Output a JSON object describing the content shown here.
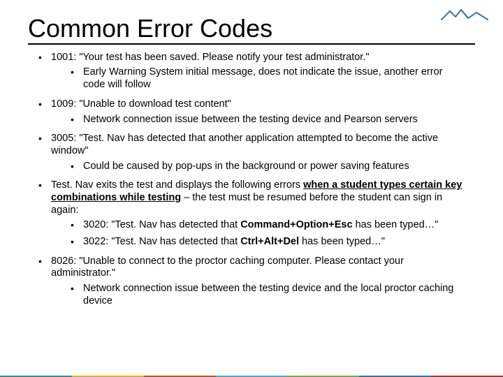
{
  "title": "Common Error Codes",
  "logo": {
    "name": "mountain-logo",
    "color": "#3f7aa6"
  },
  "bullets": [
    {
      "text": "1001: \"Your test has been saved. Please notify your test administrator.\"",
      "sub": [
        {
          "text": "Early Warning System initial message, does not indicate the issue, another error code will follow"
        }
      ]
    },
    {
      "text": "1009: \"Unable to download test content\"",
      "sub": [
        {
          "text": "Network connection issue between the testing device and Pearson servers"
        }
      ]
    },
    {
      "text": "3005: \"Test. Nav has detected that another application attempted to become the active window\"",
      "sub": [
        {
          "text": "Could be caused by pop-ups in the background or power saving features"
        }
      ]
    },
    {
      "pre": "Test. Nav exits the test and displays the following errors ",
      "bold_u": "when a student types certain key combinations while testing",
      "post": " – the test must be resumed before the student can sign in again:",
      "sub": [
        {
          "pre": "3020: \"Test. Nav has detected that ",
          "bold": "Command+Option+Esc",
          "post": " has been typed…\""
        },
        {
          "pre": "3022: \"Test. Nav has detected that ",
          "bold": "Ctrl+Alt+Del",
          "post": " has been typed…\""
        }
      ]
    },
    {
      "text": "8026: \"Unable to connect to the proctor caching computer. Please contact your administrator.\"",
      "sub": [
        {
          "text": "Network connection issue between the testing device and the local proctor caching device"
        }
      ]
    }
  ],
  "footer_colors": [
    "#3b8a96",
    "#d9b13b",
    "#b05a2a",
    "#5aa0c8",
    "#7aa64e",
    "#3f6fa3",
    "#a03a3a"
  ]
}
